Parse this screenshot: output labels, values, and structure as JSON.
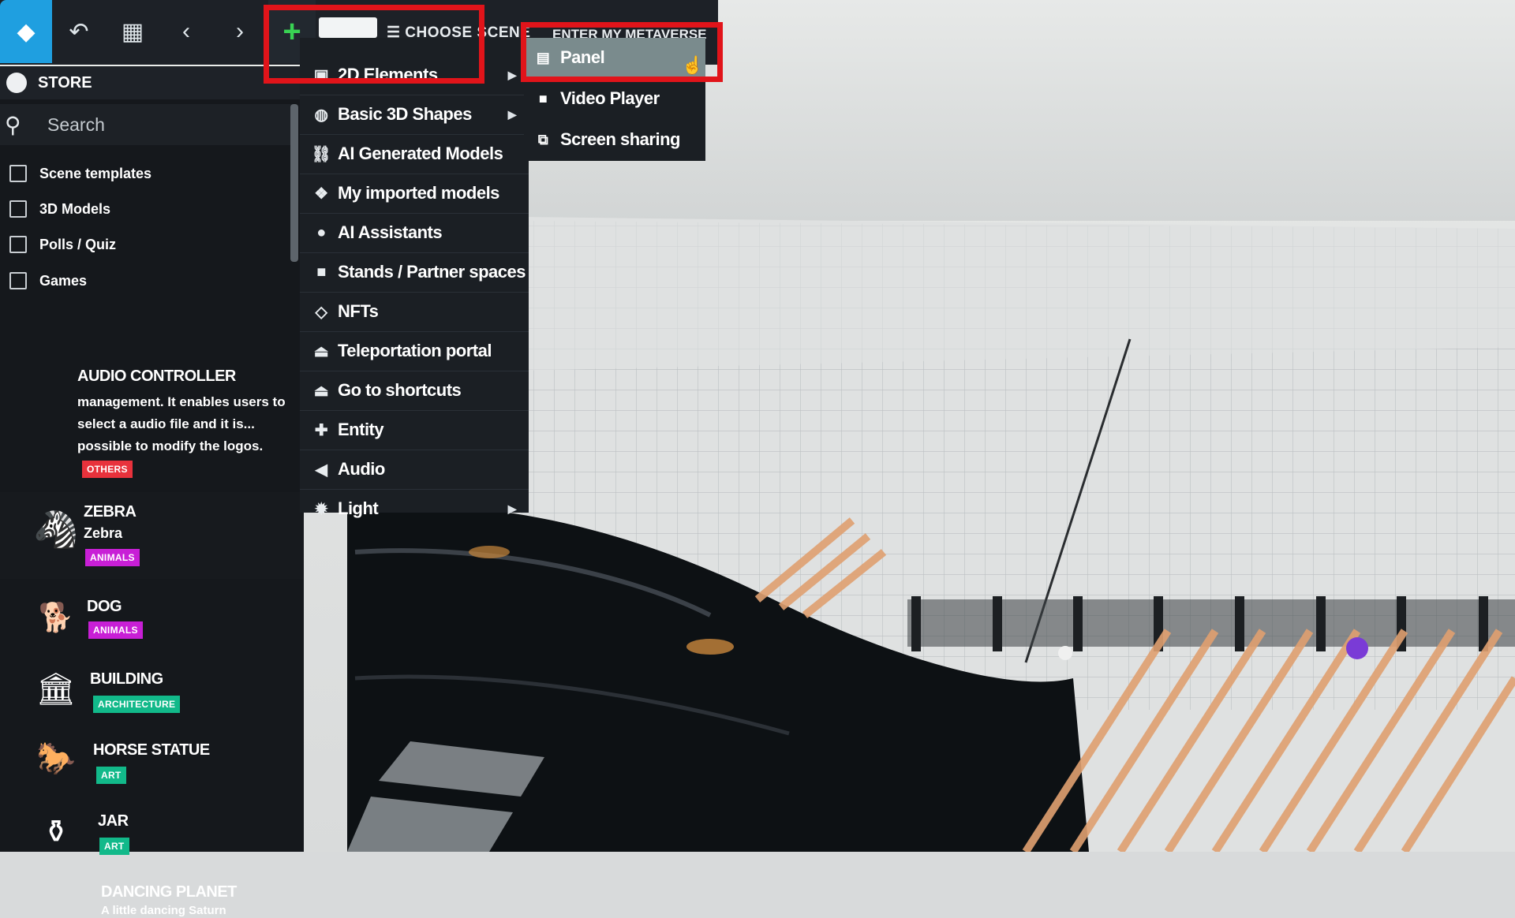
{
  "toolbar": {
    "choose_scene": "☰ CHOOSE SCENE",
    "enter_metaverse": "ENTER MY METAVERSE"
  },
  "icons": {
    "logo": "diamond-icon",
    "undo": "undo-icon",
    "grid": "layout-icon",
    "back": "chevron-left-icon",
    "forward": "chevron-right-icon",
    "add": "plus-icon"
  },
  "store": {
    "title": "STORE",
    "search_placeholder": "Search",
    "filters": [
      "Scene templates",
      "3D Models",
      "Polls / Quiz",
      "Games"
    ],
    "items": [
      {
        "title": "AUDIO CONTROLLER",
        "description": "management. It enables users to select a audio file and it is... possible to modify the logos.",
        "badge": "OTHERS"
      },
      {
        "title": "ZEBRA",
        "subtitle": "Zebra",
        "badge": "ANIMALS"
      },
      {
        "title": "DOG",
        "badge": "ANIMALS"
      },
      {
        "title": "BUILDING",
        "badge": "ARCHITECTURE"
      },
      {
        "title": "HORSE STATUE",
        "badge": "ART"
      },
      {
        "title": "JAR",
        "badge": "ART"
      },
      {
        "title": "DANCING PLANET",
        "subtitle": "A little dancing Saturn"
      }
    ]
  },
  "menu": {
    "items": [
      {
        "label": "2D Elements",
        "has_submenu": true
      },
      {
        "label": "Basic 3D Shapes",
        "has_submenu": true
      },
      {
        "label": "AI Generated Models"
      },
      {
        "label": "My imported models"
      },
      {
        "label": "AI Assistants"
      },
      {
        "label": "Stands / Partner spaces"
      },
      {
        "label": "NFTs"
      },
      {
        "label": "Teleportation portal"
      },
      {
        "label": "Go to shortcuts"
      },
      {
        "label": "Entity"
      },
      {
        "label": "Audio"
      },
      {
        "label": "Light",
        "has_submenu": true
      }
    ],
    "submenu": [
      {
        "label": "Panel",
        "highlighted": true
      },
      {
        "label": "Video Player"
      },
      {
        "label": "Screen sharing"
      }
    ]
  },
  "colors": {
    "accent_blue": "#1f9fe0",
    "add_green": "#39d353",
    "highlight_red": "#e1141a",
    "badge_others": "#e8323c",
    "badge_animals": "#c81fd6",
    "badge_architecture": "#12b98a",
    "badge_art": "#12b98a"
  }
}
